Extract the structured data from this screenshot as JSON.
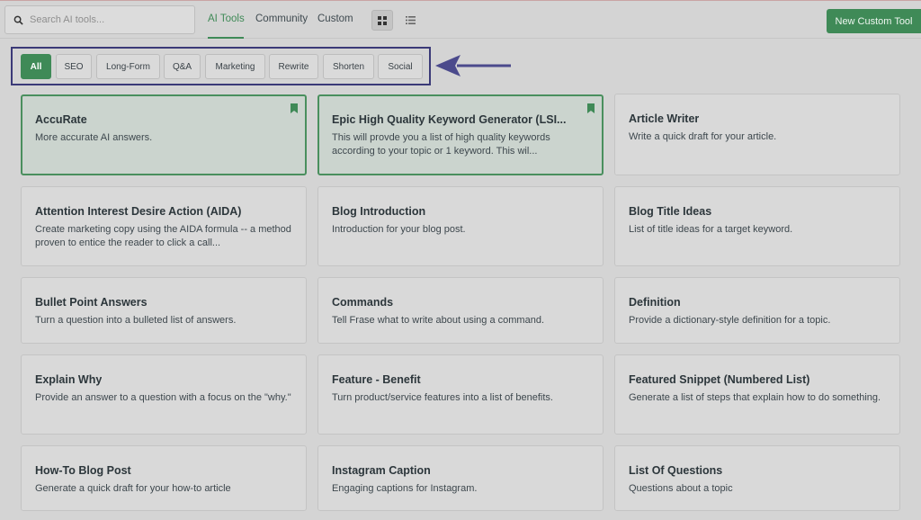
{
  "search": {
    "placeholder": "Search AI tools..."
  },
  "tabs": [
    {
      "label": "AI Tools",
      "active": true
    },
    {
      "label": "Community",
      "active": false
    },
    {
      "label": "Custom",
      "active": false
    }
  ],
  "view_toggle": {
    "grid_icon": "grid-icon",
    "list_icon": "list-icon",
    "active": "grid"
  },
  "new_tool_label": "New Custom Tool",
  "filters": [
    "All",
    "SEO",
    "Long-Form",
    "Q&A",
    "Marketing",
    "Rewrite",
    "Shorten",
    "Social"
  ],
  "active_filter": "All",
  "colors": {
    "accent": "#3f8a57",
    "highlight_box": "#3b3a78",
    "arrow": "#4b4a8c"
  },
  "cards": [
    {
      "title": "AccuRate",
      "desc": "More accurate AI answers.",
      "bookmarked": true
    },
    {
      "title": "Epic High Quality Keyword Generator (LSI...",
      "desc": "This will provde you a list of high quality keywords according to your topic or 1 keyword. This wil...",
      "bookmarked": true
    },
    {
      "title": "Article Writer",
      "desc": "Write a quick draft for your article.",
      "bookmarked": false
    },
    {
      "title": "Attention Interest Desire Action (AIDA)",
      "desc": "Create marketing copy using the AIDA formula -- a method proven to entice the reader to click a call...",
      "bookmarked": false
    },
    {
      "title": "Blog Introduction",
      "desc": "Introduction for your blog post.",
      "bookmarked": false
    },
    {
      "title": "Blog Title Ideas",
      "desc": "List of title ideas for a target keyword.",
      "bookmarked": false
    },
    {
      "title": "Bullet Point Answers",
      "desc": "Turn a question into a bulleted list of answers.",
      "bookmarked": false
    },
    {
      "title": "Commands",
      "desc": "Tell Frase what to write about using a command.",
      "bookmarked": false
    },
    {
      "title": "Definition",
      "desc": "Provide a dictionary-style definition for a topic.",
      "bookmarked": false
    },
    {
      "title": "Explain Why",
      "desc": "Provide an answer to a question with a focus on the \"why.\"",
      "bookmarked": false
    },
    {
      "title": "Feature - Benefit",
      "desc": "Turn product/service features into a list of benefits.",
      "bookmarked": false
    },
    {
      "title": "Featured Snippet (Numbered List)",
      "desc": "Generate a list of steps that explain how to do something.",
      "bookmarked": false
    },
    {
      "title": "How-To Blog Post",
      "desc": "Generate a quick draft for your how-to article",
      "bookmarked": false
    },
    {
      "title": "Instagram Caption",
      "desc": "Engaging captions for Instagram.",
      "bookmarked": false
    },
    {
      "title": "List Of Questions",
      "desc": "Questions about a topic",
      "bookmarked": false
    }
  ]
}
